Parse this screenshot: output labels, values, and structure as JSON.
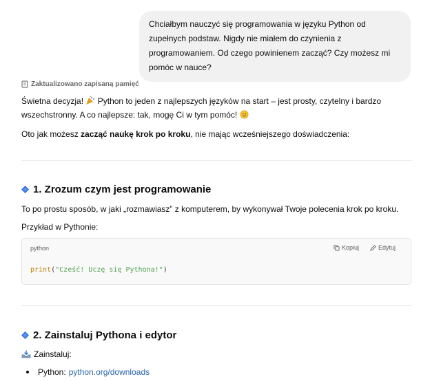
{
  "user_message": "Chciałbym nauczyć się programowania w języku Python od zupełnych podstaw. Nigdy nie miałem do czynienia z programowaniem. Od czego powinienem zacząć? Czy możesz mi pomóc w nauce?",
  "memory_notice": "Zaktualizowano zapisaną pamięć",
  "intro": {
    "part1": "Świetna decyzja! ",
    "part2": " Python to jeden z najlepszych języków na start – jest prosty, czytelny i bardzo wszechstronny. A co najlepsze: tak, mogę Ci w tym pomóc! ",
    "plan_prefix": "Oto jak możesz ",
    "plan_bold": "zacząć naukę krok po kroku",
    "plan_suffix": ", nie mając wcześniejszego doświadczenia:"
  },
  "section1": {
    "title": "1. Zrozum czym jest programowanie",
    "body": "To po prostu sposób, w jaki „rozmawiasz” z komputerem, by wykonywał Twoje polecenia krok po kroku.",
    "example_label": "Przykład w Pythonie:"
  },
  "code": {
    "language": "python",
    "copy_label": "Kopiuj",
    "edit_label": "Edytuj",
    "fn": "print",
    "open": "(",
    "string": "\"Cześć! Uczę się Pythona!\"",
    "close": ")"
  },
  "section2": {
    "title": "2. Zainstaluj Pythona i edytor",
    "install_label": "Zainstaluj:",
    "items": [
      {
        "label": "Python:",
        "link": "python.org/downloads"
      }
    ]
  },
  "icons": {
    "memory": "memory-icon",
    "party": "party-popper-icon",
    "smile": "smiling-face-icon",
    "diamond": "blue-diamond-icon",
    "inbox": "inbox-tray-icon",
    "copy": "copy-icon",
    "edit": "pencil-icon"
  },
  "colors": {
    "accent_link": "#2964aa",
    "diamond": "#2f6bd8",
    "bubble_bg": "#f1f1f1"
  }
}
